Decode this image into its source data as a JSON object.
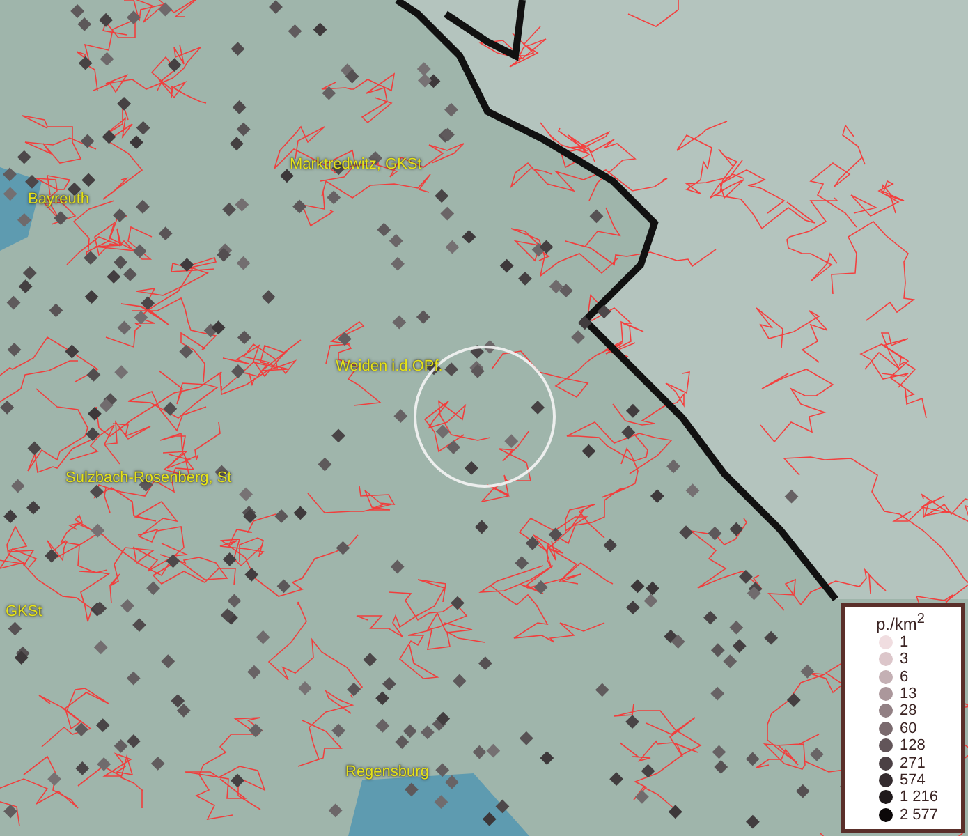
{
  "map": {
    "places": [
      {
        "name": "Marktredwitz, GKSt"
      },
      {
        "name": "Bayreuth"
      },
      {
        "name": "Weiden i.d.OPf."
      },
      {
        "name": "Sulzbach-Rosenberg, St"
      },
      {
        "name": "GKSt"
      },
      {
        "name": "Regensburg"
      }
    ]
  },
  "legend": {
    "title": "p./km$^{2}$",
    "items": [
      {
        "label": "1",
        "color": "#f0dde0"
      },
      {
        "label": "3",
        "color": "#dcc6ca"
      },
      {
        "label": "6",
        "color": "#c4b0b4"
      },
      {
        "label": "13",
        "color": "#ab979b"
      },
      {
        "label": "28",
        "color": "#928084"
      },
      {
        "label": "60",
        "color": "#7a6a6e"
      },
      {
        "label": "128",
        "color": "#625559"
      },
      {
        "label": "271",
        "color": "#4b4044"
      },
      {
        "label": "574",
        "color": "#352c2f"
      },
      {
        "label": "1 216",
        "color": "#201a1c"
      },
      {
        "label": "2 577",
        "color": "#0c0809"
      }
    ]
  }
}
